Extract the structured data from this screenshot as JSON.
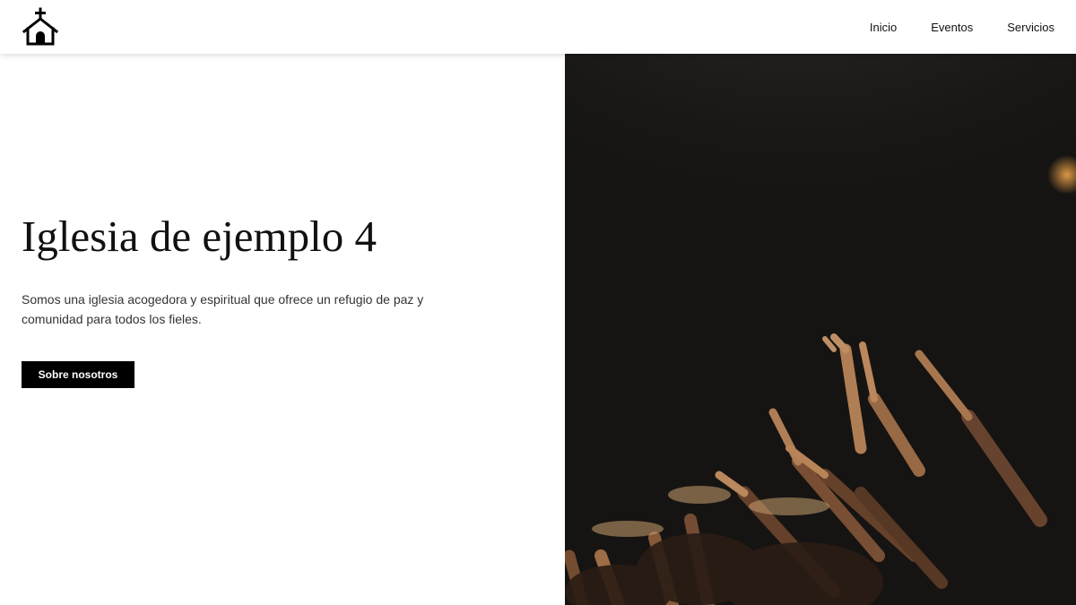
{
  "header": {
    "logo_icon": "church-icon",
    "nav": [
      {
        "label": "Inicio"
      },
      {
        "label": "Eventos"
      },
      {
        "label": "Servicios"
      }
    ]
  },
  "hero": {
    "title": "Iglesia de ejemplo 4",
    "description": "Somos una iglesia acogedora y espiritual que ofrece un refugio de paz y comunidad para todos los fieles.",
    "button_label": "Sobre nosotros",
    "image_subject": "raised hands of a crowd under a spotlight"
  },
  "colors": {
    "button_bg": "#000000",
    "button_text": "#ffffff",
    "text": "#111111",
    "image_bg": "#161412"
  }
}
